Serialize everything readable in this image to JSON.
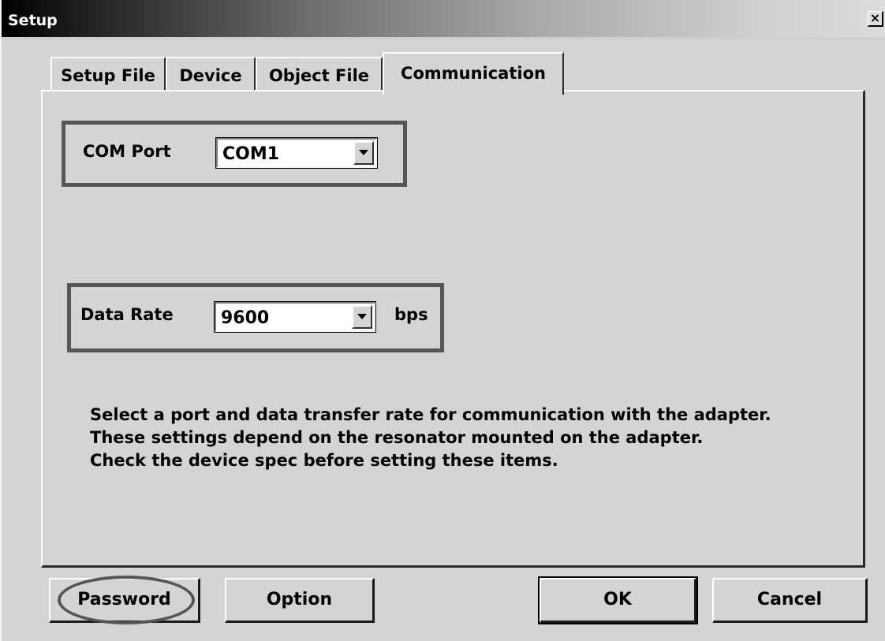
{
  "window": {
    "title": "Setup",
    "close_glyph": "×"
  },
  "tabs": [
    {
      "label": "Setup File",
      "active": false
    },
    {
      "label": "Device",
      "active": false
    },
    {
      "label": "Object File",
      "active": false
    },
    {
      "label": "Communication",
      "active": true
    }
  ],
  "communication": {
    "com_port": {
      "label": "COM Port",
      "selected": "COM1"
    },
    "data_rate": {
      "label": "Data Rate",
      "selected": "9600",
      "unit": "bps"
    },
    "help_lines": [
      "Select a port and data transfer rate for communication with the adapter.",
      "These settings depend on the resonator mounted on the adapter.",
      "Check the device spec before setting these items."
    ]
  },
  "buttons": {
    "password": "Password",
    "option": "Option",
    "ok": "OK",
    "cancel": "Cancel"
  },
  "icons": {
    "close": "close-icon",
    "dropdown": "chevron-down-icon"
  },
  "colors": {
    "dialog_bg": "#d4d4d4",
    "highlight_outline": "#555555"
  }
}
